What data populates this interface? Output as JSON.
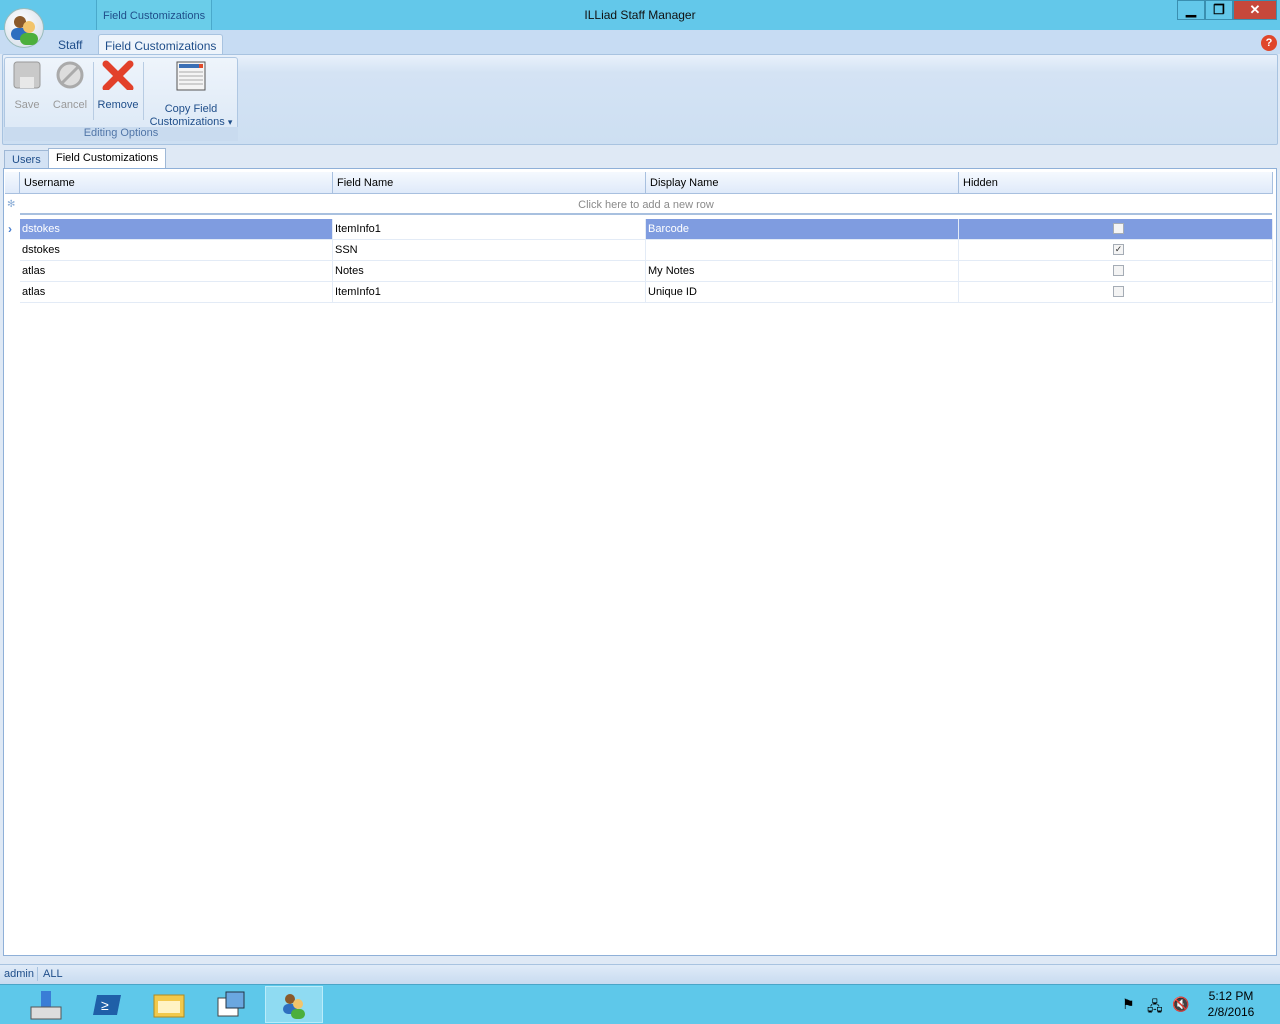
{
  "window": {
    "title": "ILLiad Staff Manager",
    "context_group": "Field Customizations",
    "minimize": "▁",
    "restore": "❐",
    "close": "✕"
  },
  "ribbon_tabs": [
    {
      "label": "Staff"
    },
    {
      "label": "Field Customizations"
    }
  ],
  "ribbon": {
    "save": "Save",
    "cancel": "Cancel",
    "remove": "Remove",
    "copy_line1": "Copy Field",
    "copy_line2": "Customizations",
    "dropdown_arrow": "▾",
    "group_label": "Editing Options",
    "help": "?"
  },
  "doc_tabs": [
    {
      "label": "Users"
    },
    {
      "label": "Field Customizations"
    }
  ],
  "grid": {
    "columns": [
      "Username",
      "Field Name",
      "Display Name",
      "Hidden"
    ],
    "new_row_text": "Click here to add a new row",
    "new_row_icon": "✻",
    "current_row_icon": "›",
    "rows": [
      {
        "username": "dstokes",
        "field_name": "ItemInfo1",
        "display_name": "Barcode",
        "hidden": false,
        "hidden_mark": ""
      },
      {
        "username": "dstokes",
        "field_name": "SSN",
        "display_name": "",
        "hidden": true,
        "hidden_mark": "✓"
      },
      {
        "username": "atlas",
        "field_name": "Notes",
        "display_name": "My Notes",
        "hidden": false,
        "hidden_mark": ""
      },
      {
        "username": "atlas",
        "field_name": "ItemInfo1",
        "display_name": "Unique ID",
        "hidden": false,
        "hidden_mark": ""
      }
    ]
  },
  "status": {
    "user": "admin",
    "scope": "ALL"
  },
  "taskbar": {
    "time": "5:12 PM",
    "date": "2/8/2016"
  }
}
